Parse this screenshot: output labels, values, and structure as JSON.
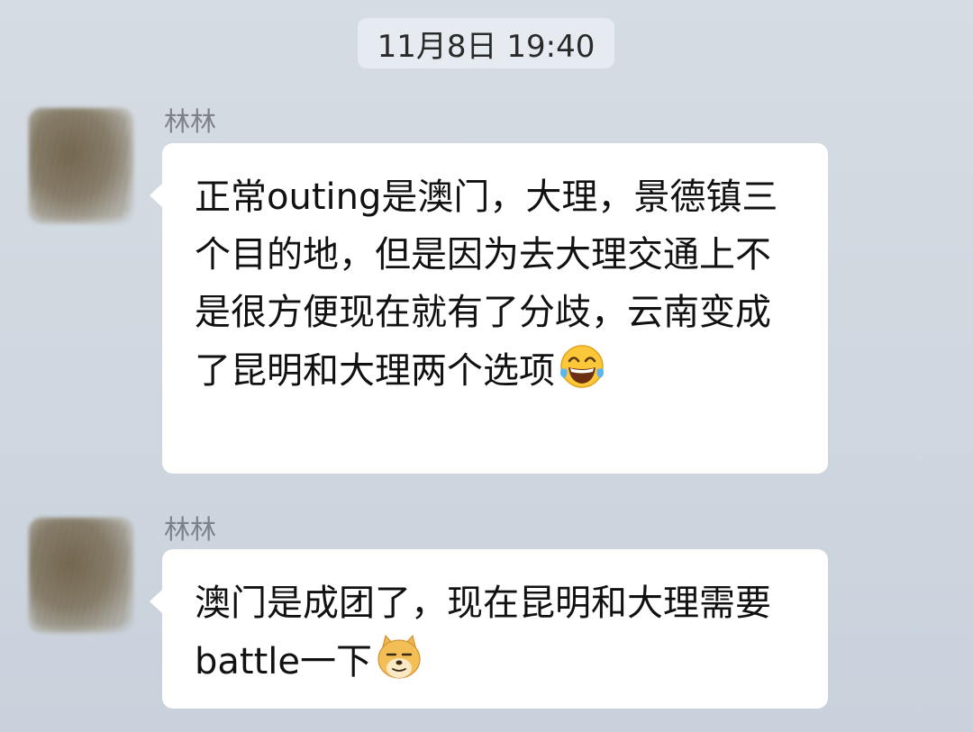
{
  "chat": {
    "timestamp": "11月8日 19:40",
    "messages": [
      {
        "sender": "林林",
        "text": "正常outing是澳门，大理，景德镇三个目的地，但是因为去大理交通上不是很方便现在就有了分歧，云南变成了昆明和大理两个选项",
        "emoji": "tears-of-joy-emoji"
      },
      {
        "sender": "林林",
        "text": "澳门是成团了，现在昆明和大理需要battle一下",
        "emoji": "doge-emoji"
      }
    ]
  }
}
